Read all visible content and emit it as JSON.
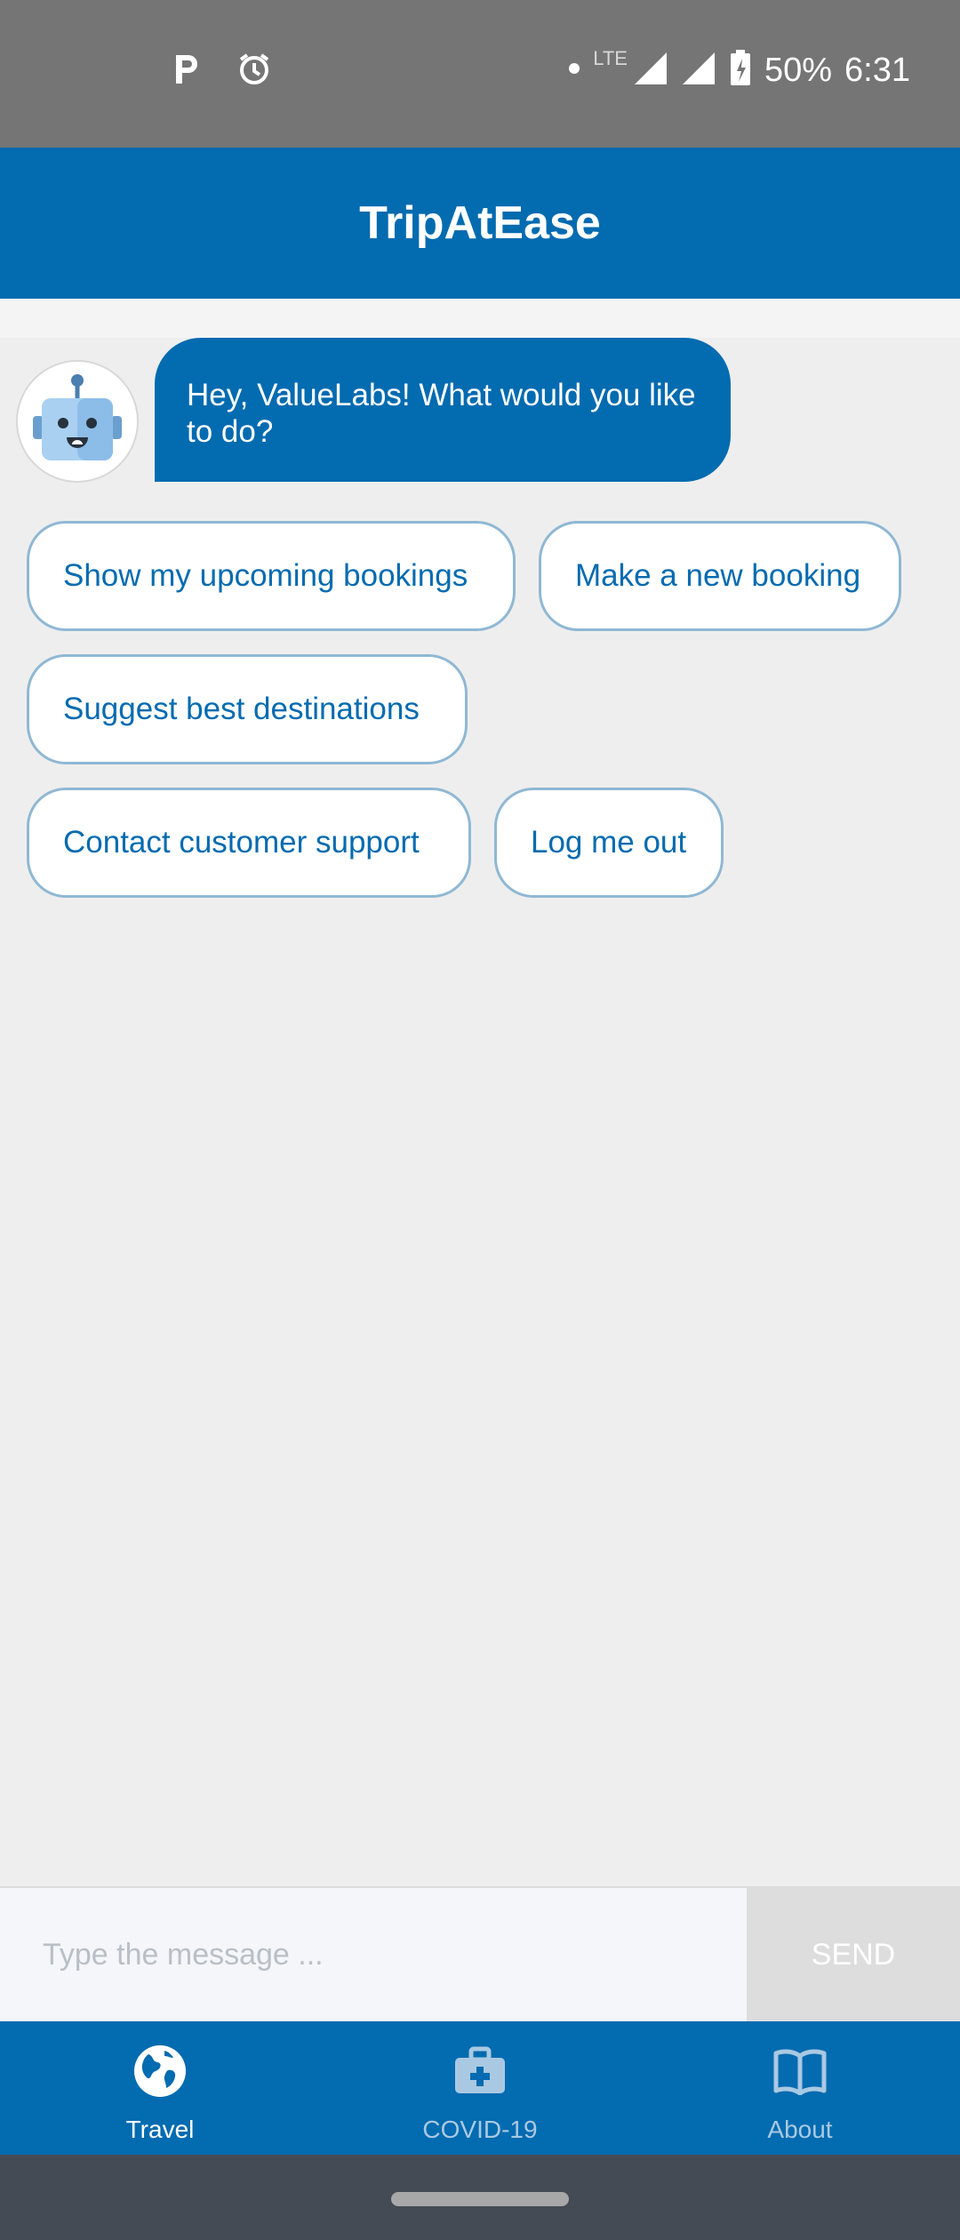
{
  "status_bar": {
    "battery": "50%",
    "time": "6:31",
    "network": "LTE"
  },
  "app_bar": {
    "title": "TripAtEase"
  },
  "chat": {
    "bot_message": "Hey, ValueLabs! What would you like to do?",
    "quick_replies": [
      [
        "Show my upcoming bookings",
        "Make a new booking"
      ],
      [
        "Suggest best destinations"
      ],
      [
        "Contact customer support",
        "Log me out"
      ]
    ]
  },
  "input": {
    "placeholder": "Type the message ...",
    "send_label": "SEND"
  },
  "bottom_nav": {
    "items": [
      {
        "label": "Travel",
        "icon": "globe-icon",
        "active": true
      },
      {
        "label": "COVID-19",
        "icon": "medical-kit-icon",
        "active": false
      },
      {
        "label": "About",
        "icon": "book-icon",
        "active": false
      }
    ]
  },
  "colors": {
    "primary": "#036bb0",
    "status_bar": "#757575",
    "background": "#eeeeee",
    "chip_border": "#8fb8d3",
    "send_disabled": "#dddddd"
  }
}
